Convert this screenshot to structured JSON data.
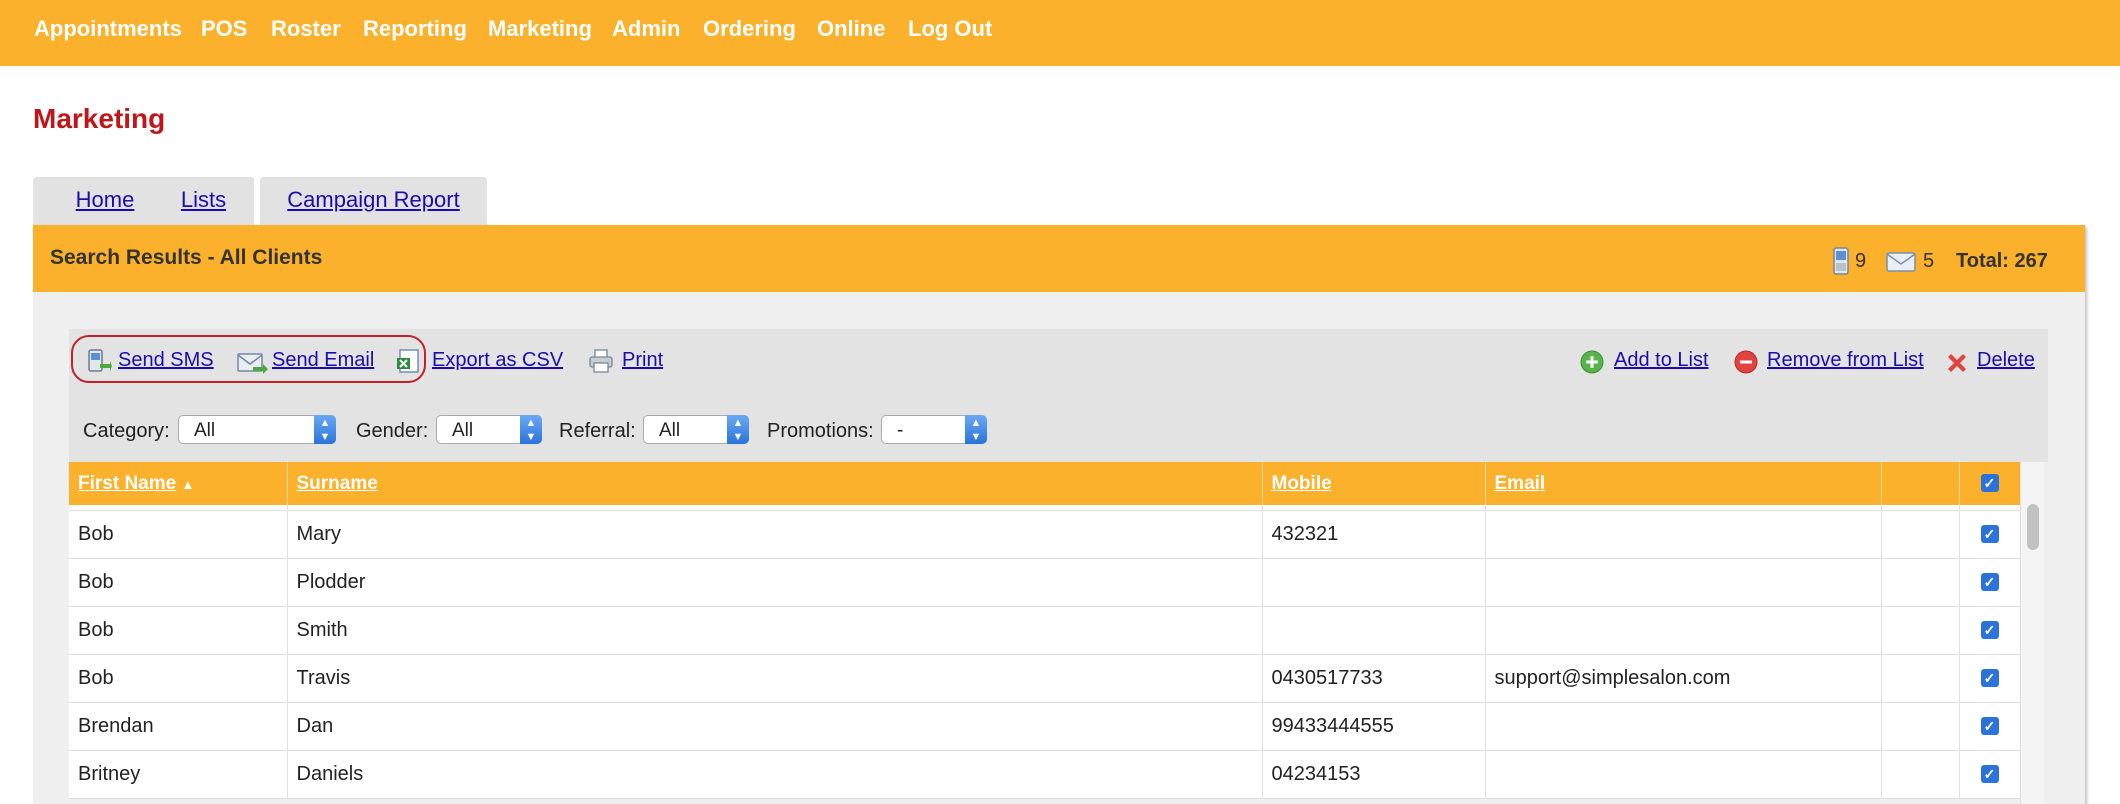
{
  "nav": {
    "items": [
      "Appointments",
      "POS",
      "Roster",
      "Reporting",
      "Marketing",
      "Admin",
      "Ordering",
      "Online",
      "Log Out"
    ]
  },
  "page": {
    "title": "Marketing"
  },
  "tabs": [
    "Home",
    "Lists",
    "Campaign Report"
  ],
  "panel": {
    "title": "Search Results - All Clients",
    "sms_count": "9",
    "email_count": "5",
    "total": "Total: 267"
  },
  "toolbar": {
    "send_sms": "Send SMS",
    "send_email": "Send Email",
    "export_csv": "Export as CSV",
    "print": "Print",
    "add_to_list": "Add to List",
    "remove_from_list": "Remove from List",
    "delete": "Delete"
  },
  "filters": {
    "category": {
      "label": "Category:",
      "value": "All"
    },
    "gender": {
      "label": "Gender:",
      "value": "All"
    },
    "referral": {
      "label": "Referral:",
      "value": "All"
    },
    "promotions": {
      "label": "Promotions:",
      "value": "-"
    }
  },
  "table": {
    "columns": [
      "First Name",
      "Surname",
      "Mobile",
      "Email"
    ],
    "sort_indicator": "▲",
    "rows": [
      {
        "first": "Bob",
        "surname": "Mary",
        "mobile": "432321",
        "email": ""
      },
      {
        "first": "Bob",
        "surname": "Plodder",
        "mobile": "",
        "email": ""
      },
      {
        "first": "Bob",
        "surname": "Smith",
        "mobile": "",
        "email": ""
      },
      {
        "first": "Bob",
        "surname": "Travis",
        "mobile": "0430517733",
        "email": "support@simplesalon.com"
      },
      {
        "first": "Brendan",
        "surname": "Dan",
        "mobile": "99433444555",
        "email": ""
      },
      {
        "first": "Britney",
        "surname": "Daniels",
        "mobile": "04234153",
        "email": ""
      }
    ]
  },
  "colors": {
    "accent": "#fbb12b",
    "title_red": "#c0161b",
    "link_blue": "#1a0dab",
    "highlight_ring": "#c0222a"
  }
}
